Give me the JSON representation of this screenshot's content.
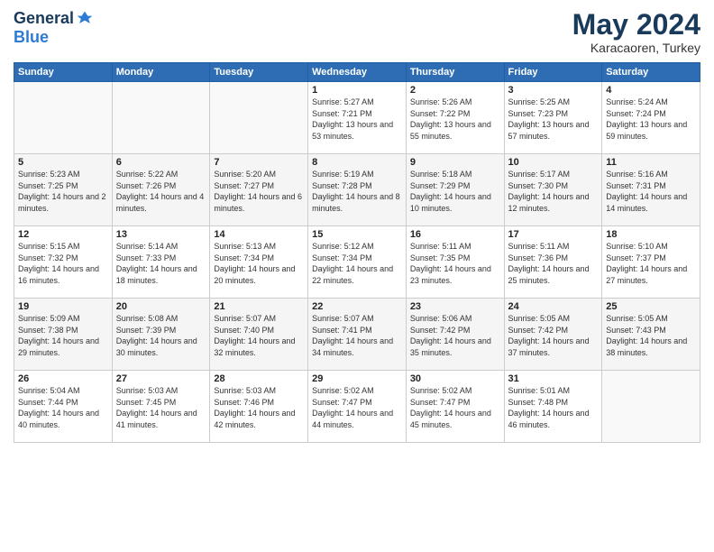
{
  "logo": {
    "general": "General",
    "blue": "Blue"
  },
  "title": {
    "month": "May 2024",
    "location": "Karacaoren, Turkey"
  },
  "weekdays": [
    "Sunday",
    "Monday",
    "Tuesday",
    "Wednesday",
    "Thursday",
    "Friday",
    "Saturday"
  ],
  "weeks": [
    [
      {
        "day": "",
        "sunrise": "",
        "sunset": "",
        "daylight": ""
      },
      {
        "day": "",
        "sunrise": "",
        "sunset": "",
        "daylight": ""
      },
      {
        "day": "",
        "sunrise": "",
        "sunset": "",
        "daylight": ""
      },
      {
        "day": "1",
        "sunrise": "Sunrise: 5:27 AM",
        "sunset": "Sunset: 7:21 PM",
        "daylight": "Daylight: 13 hours and 53 minutes."
      },
      {
        "day": "2",
        "sunrise": "Sunrise: 5:26 AM",
        "sunset": "Sunset: 7:22 PM",
        "daylight": "Daylight: 13 hours and 55 minutes."
      },
      {
        "day": "3",
        "sunrise": "Sunrise: 5:25 AM",
        "sunset": "Sunset: 7:23 PM",
        "daylight": "Daylight: 13 hours and 57 minutes."
      },
      {
        "day": "4",
        "sunrise": "Sunrise: 5:24 AM",
        "sunset": "Sunset: 7:24 PM",
        "daylight": "Daylight: 13 hours and 59 minutes."
      }
    ],
    [
      {
        "day": "5",
        "sunrise": "Sunrise: 5:23 AM",
        "sunset": "Sunset: 7:25 PM",
        "daylight": "Daylight: 14 hours and 2 minutes."
      },
      {
        "day": "6",
        "sunrise": "Sunrise: 5:22 AM",
        "sunset": "Sunset: 7:26 PM",
        "daylight": "Daylight: 14 hours and 4 minutes."
      },
      {
        "day": "7",
        "sunrise": "Sunrise: 5:20 AM",
        "sunset": "Sunset: 7:27 PM",
        "daylight": "Daylight: 14 hours and 6 minutes."
      },
      {
        "day": "8",
        "sunrise": "Sunrise: 5:19 AM",
        "sunset": "Sunset: 7:28 PM",
        "daylight": "Daylight: 14 hours and 8 minutes."
      },
      {
        "day": "9",
        "sunrise": "Sunrise: 5:18 AM",
        "sunset": "Sunset: 7:29 PM",
        "daylight": "Daylight: 14 hours and 10 minutes."
      },
      {
        "day": "10",
        "sunrise": "Sunrise: 5:17 AM",
        "sunset": "Sunset: 7:30 PM",
        "daylight": "Daylight: 14 hours and 12 minutes."
      },
      {
        "day": "11",
        "sunrise": "Sunrise: 5:16 AM",
        "sunset": "Sunset: 7:31 PM",
        "daylight": "Daylight: 14 hours and 14 minutes."
      }
    ],
    [
      {
        "day": "12",
        "sunrise": "Sunrise: 5:15 AM",
        "sunset": "Sunset: 7:32 PM",
        "daylight": "Daylight: 14 hours and 16 minutes."
      },
      {
        "day": "13",
        "sunrise": "Sunrise: 5:14 AM",
        "sunset": "Sunset: 7:33 PM",
        "daylight": "Daylight: 14 hours and 18 minutes."
      },
      {
        "day": "14",
        "sunrise": "Sunrise: 5:13 AM",
        "sunset": "Sunset: 7:34 PM",
        "daylight": "Daylight: 14 hours and 20 minutes."
      },
      {
        "day": "15",
        "sunrise": "Sunrise: 5:12 AM",
        "sunset": "Sunset: 7:34 PM",
        "daylight": "Daylight: 14 hours and 22 minutes."
      },
      {
        "day": "16",
        "sunrise": "Sunrise: 5:11 AM",
        "sunset": "Sunset: 7:35 PM",
        "daylight": "Daylight: 14 hours and 23 minutes."
      },
      {
        "day": "17",
        "sunrise": "Sunrise: 5:11 AM",
        "sunset": "Sunset: 7:36 PM",
        "daylight": "Daylight: 14 hours and 25 minutes."
      },
      {
        "day": "18",
        "sunrise": "Sunrise: 5:10 AM",
        "sunset": "Sunset: 7:37 PM",
        "daylight": "Daylight: 14 hours and 27 minutes."
      }
    ],
    [
      {
        "day": "19",
        "sunrise": "Sunrise: 5:09 AM",
        "sunset": "Sunset: 7:38 PM",
        "daylight": "Daylight: 14 hours and 29 minutes."
      },
      {
        "day": "20",
        "sunrise": "Sunrise: 5:08 AM",
        "sunset": "Sunset: 7:39 PM",
        "daylight": "Daylight: 14 hours and 30 minutes."
      },
      {
        "day": "21",
        "sunrise": "Sunrise: 5:07 AM",
        "sunset": "Sunset: 7:40 PM",
        "daylight": "Daylight: 14 hours and 32 minutes."
      },
      {
        "day": "22",
        "sunrise": "Sunrise: 5:07 AM",
        "sunset": "Sunset: 7:41 PM",
        "daylight": "Daylight: 14 hours and 34 minutes."
      },
      {
        "day": "23",
        "sunrise": "Sunrise: 5:06 AM",
        "sunset": "Sunset: 7:42 PM",
        "daylight": "Daylight: 14 hours and 35 minutes."
      },
      {
        "day": "24",
        "sunrise": "Sunrise: 5:05 AM",
        "sunset": "Sunset: 7:42 PM",
        "daylight": "Daylight: 14 hours and 37 minutes."
      },
      {
        "day": "25",
        "sunrise": "Sunrise: 5:05 AM",
        "sunset": "Sunset: 7:43 PM",
        "daylight": "Daylight: 14 hours and 38 minutes."
      }
    ],
    [
      {
        "day": "26",
        "sunrise": "Sunrise: 5:04 AM",
        "sunset": "Sunset: 7:44 PM",
        "daylight": "Daylight: 14 hours and 40 minutes."
      },
      {
        "day": "27",
        "sunrise": "Sunrise: 5:03 AM",
        "sunset": "Sunset: 7:45 PM",
        "daylight": "Daylight: 14 hours and 41 minutes."
      },
      {
        "day": "28",
        "sunrise": "Sunrise: 5:03 AM",
        "sunset": "Sunset: 7:46 PM",
        "daylight": "Daylight: 14 hours and 42 minutes."
      },
      {
        "day": "29",
        "sunrise": "Sunrise: 5:02 AM",
        "sunset": "Sunset: 7:47 PM",
        "daylight": "Daylight: 14 hours and 44 minutes."
      },
      {
        "day": "30",
        "sunrise": "Sunrise: 5:02 AM",
        "sunset": "Sunset: 7:47 PM",
        "daylight": "Daylight: 14 hours and 45 minutes."
      },
      {
        "day": "31",
        "sunrise": "Sunrise: 5:01 AM",
        "sunset": "Sunset: 7:48 PM",
        "daylight": "Daylight: 14 hours and 46 minutes."
      },
      {
        "day": "",
        "sunrise": "",
        "sunset": "",
        "daylight": ""
      }
    ]
  ]
}
